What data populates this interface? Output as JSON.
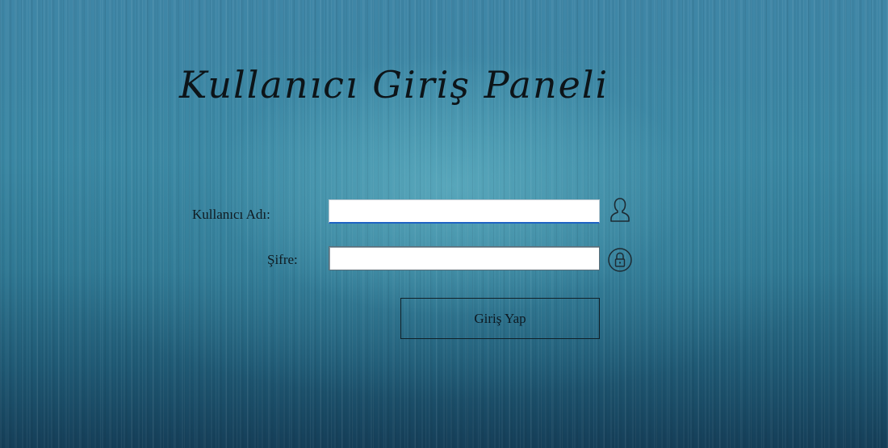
{
  "header": {
    "title": "Kullanıcı Giriş Paneli"
  },
  "form": {
    "username_label": "Kullanıcı Adı:",
    "username_value": "",
    "password_label": "Şifre:",
    "password_value": "",
    "submit_label": "Giriş Yap"
  },
  "icons": {
    "username": "user-icon",
    "password": "lock-icon"
  },
  "colors": {
    "background": "#3a87a3",
    "focus_border": "#1f63c4",
    "text": "#0d1418"
  }
}
